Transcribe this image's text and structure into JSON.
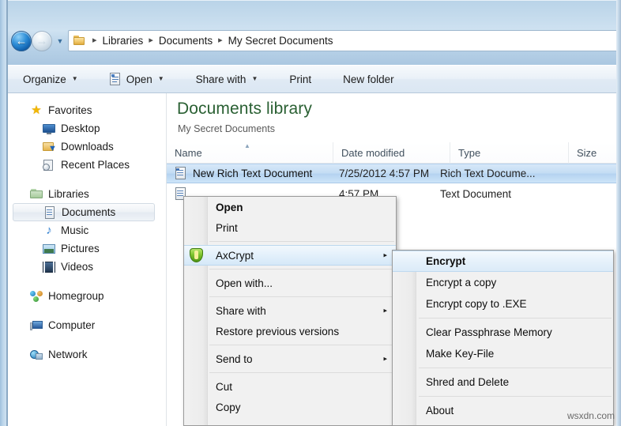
{
  "nav": {
    "back_label": "←",
    "forward_label": "→",
    "dropdown_label": "▼",
    "folder_icon": "folder-icon",
    "breadcrumbs": [
      {
        "label": "Libraries"
      },
      {
        "label": "Documents"
      },
      {
        "label": "My Secret Documents"
      }
    ],
    "separator": "▸"
  },
  "toolbar": {
    "items": [
      {
        "label": "Organize",
        "caret": "▼",
        "icon": ""
      },
      {
        "label": "Open",
        "caret": "▼",
        "icon": "document-icon"
      },
      {
        "label": "Share with",
        "caret": "▼",
        "icon": ""
      },
      {
        "label": "Print",
        "caret": "",
        "icon": ""
      },
      {
        "label": "New folder",
        "caret": "",
        "icon": ""
      }
    ]
  },
  "sidebar": {
    "groups": [
      {
        "header": {
          "label": "Favorites",
          "icon": "star-icon"
        },
        "items": [
          {
            "label": "Desktop",
            "icon": "desktop-icon"
          },
          {
            "label": "Downloads",
            "icon": "downloads-icon"
          },
          {
            "label": "Recent Places",
            "icon": "recent-places-icon"
          }
        ]
      },
      {
        "header": {
          "label": "Libraries",
          "icon": "library-icon"
        },
        "items": [
          {
            "label": "Documents",
            "icon": "documents-icon",
            "selected": true
          },
          {
            "label": "Music",
            "icon": "music-icon"
          },
          {
            "label": "Pictures",
            "icon": "pictures-icon"
          },
          {
            "label": "Videos",
            "icon": "videos-icon"
          }
        ]
      },
      {
        "header": {
          "label": "Homegroup",
          "icon": "homegroup-icon"
        },
        "items": []
      },
      {
        "header": {
          "label": "Computer",
          "icon": "computer-icon"
        },
        "items": []
      },
      {
        "header": {
          "label": "Network",
          "icon": "network-icon"
        },
        "items": []
      }
    ]
  },
  "content": {
    "library_title": "Documents library",
    "library_subtitle": "My Secret Documents",
    "columns": [
      {
        "label": "Name",
        "sorted": true,
        "sort_caret": "▲"
      },
      {
        "label": "Date modified"
      },
      {
        "label": "Type"
      },
      {
        "label": "Size"
      }
    ],
    "files": [
      {
        "name": "New Rich Text Document",
        "date": "7/25/2012 4:57 PM",
        "type": "Rich Text Docume...",
        "size": "",
        "selected": true,
        "icon": "rich-text-document-icon"
      },
      {
        "name": "",
        "date": "4:57 PM",
        "type": "Text Document",
        "size": "",
        "selected": false,
        "icon": "text-document-icon"
      }
    ]
  },
  "context_menu": {
    "items": [
      {
        "label": "Open",
        "bold": true,
        "type": "item"
      },
      {
        "label": "Print",
        "type": "item"
      },
      {
        "type": "separator"
      },
      {
        "label": "AxCrypt",
        "type": "item",
        "highlight": true,
        "submenu_arrow": "▸",
        "icon": "axcrypt-shield-icon"
      },
      {
        "type": "separator"
      },
      {
        "label": "Open with...",
        "type": "item"
      },
      {
        "type": "separator"
      },
      {
        "label": "Share with",
        "type": "item",
        "submenu_arrow": "▸"
      },
      {
        "label": "Restore previous versions",
        "type": "item"
      },
      {
        "type": "separator"
      },
      {
        "label": "Send to",
        "type": "item",
        "submenu_arrow": "▸"
      },
      {
        "type": "separator"
      },
      {
        "label": "Cut",
        "type": "item"
      },
      {
        "label": "Copy",
        "type": "item"
      }
    ]
  },
  "submenu": {
    "items": [
      {
        "label": "Encrypt",
        "bold": true,
        "highlight": true,
        "type": "item"
      },
      {
        "label": "Encrypt a copy",
        "type": "item"
      },
      {
        "label": "Encrypt copy to .EXE",
        "type": "item"
      },
      {
        "type": "separator"
      },
      {
        "label": "Clear Passphrase Memory",
        "type": "item"
      },
      {
        "label": "Make Key-File",
        "type": "item"
      },
      {
        "type": "separator"
      },
      {
        "label": "Shred and Delete",
        "type": "item"
      },
      {
        "type": "separator"
      },
      {
        "label": "About",
        "type": "item"
      }
    ]
  },
  "watermark": {
    "text": "wsxdn.com"
  },
  "colors": {
    "accent": "#2a6033",
    "selection": "#c4ddf4",
    "glass": "#c3daec",
    "shield_green": "#7fc52e"
  }
}
